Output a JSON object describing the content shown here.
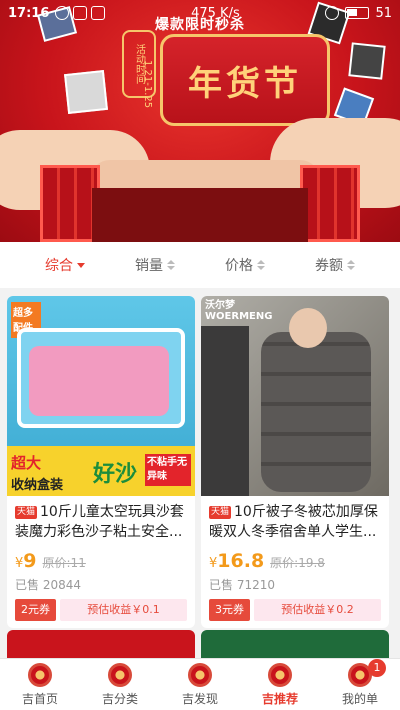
{
  "status_bar": {
    "time": "17:16",
    "network_speed": "475 K/s",
    "battery": "51"
  },
  "banner": {
    "promo_title": "爆款限时秒杀",
    "plaque_text": "年货节",
    "event_label": "活动时间",
    "event_date": "1.21-1.25"
  },
  "sort_bar": {
    "items": [
      {
        "label": "综合",
        "active": true
      },
      {
        "label": "销量",
        "active": false
      },
      {
        "label": "价格",
        "active": false
      },
      {
        "label": "券额",
        "active": false
      }
    ]
  },
  "products": [
    {
      "title": "10斤儿童太空玩具沙套装魔力彩色沙子粘土安全...",
      "badge": "天猫",
      "currency": "¥",
      "price": "9",
      "original_price": "原价:11",
      "sold": "已售 20844",
      "coupon": "2元券",
      "earnings": "预估收益￥0.1",
      "image_text": {
        "badge": "超多配件",
        "line1": "超大",
        "line2": "收纳盒装",
        "line3": "好沙",
        "line4": "不粘手无异味"
      }
    },
    {
      "title": "10斤被子冬被芯加厚保暖双人冬季宿舍单人学生...",
      "badge": "天猫",
      "currency": "¥",
      "price": "16.8",
      "original_price": "原价:19.8",
      "sold": "已售 71210",
      "coupon": "3元券",
      "earnings": "预估收益￥0.2",
      "image_text": {
        "brand_cn": "沃尔梦",
        "brand_en": "WOERMENG"
      }
    }
  ],
  "bottom_nav": {
    "items": [
      {
        "label": "吉首页",
        "icon": "home-icon",
        "active": false
      },
      {
        "label": "吉分类",
        "icon": "category-icon",
        "active": false
      },
      {
        "label": "吉发现",
        "icon": "discover-icon",
        "active": false
      },
      {
        "label": "吉推荐",
        "icon": "recommend-icon",
        "active": true
      },
      {
        "label": "我的单",
        "icon": "orders-icon",
        "active": false,
        "badge": "1"
      }
    ]
  },
  "colors": {
    "accent": "#e63b2e",
    "price": "#f39a1b",
    "banner_red": "#c8141b"
  }
}
